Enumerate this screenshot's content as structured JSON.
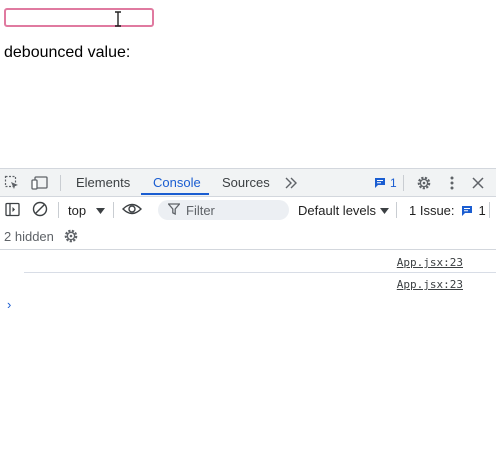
{
  "app": {
    "input": {
      "value": "",
      "placeholder": ""
    },
    "debounced_label": "debounced value:",
    "debounced_value": ""
  },
  "devtools": {
    "tabs": [
      {
        "label": "Elements",
        "active": false
      },
      {
        "label": "Console",
        "active": true
      },
      {
        "label": "Sources",
        "active": false
      }
    ],
    "more_tabs_icon": "chevron-double-right-icon",
    "issues_badge_count": "1",
    "toolbar": {
      "context": "top",
      "filter_placeholder": "Filter",
      "levels": "Default levels",
      "issues_label": "1 Issue:",
      "issues_count": "1",
      "hidden": "2 hidden"
    },
    "console": {
      "messages": [
        {
          "source": "App.jsx:23"
        },
        {
          "source": "App.jsx:23"
        }
      ],
      "prompt": "›"
    }
  },
  "colors": {
    "accent": "#1a5dd1",
    "input_border": "#e07aa0",
    "tabbar_bg": "#f1f3f4"
  }
}
